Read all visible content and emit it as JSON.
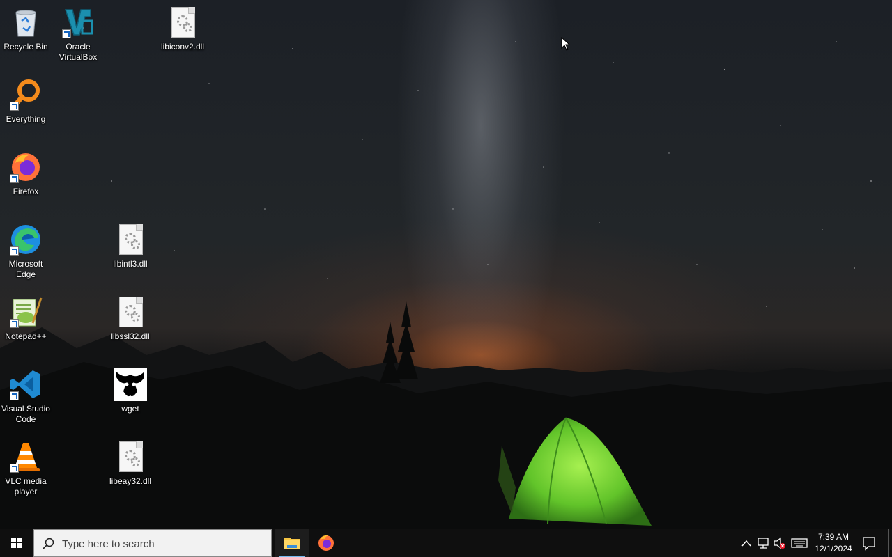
{
  "desktop": {
    "icons": [
      {
        "name": "recycle-bin",
        "label": "Recycle Bin"
      },
      {
        "name": "oracle-virtualbox",
        "label": "Oracle VirtualBox"
      },
      {
        "name": "libiconv2-dll",
        "label": "libiconv2.dll"
      },
      {
        "name": "everything",
        "label": "Everything"
      },
      {
        "name": "firefox",
        "label": "Firefox"
      },
      {
        "name": "microsoft-edge",
        "label": "Microsoft Edge"
      },
      {
        "name": "libintl3-dll",
        "label": "libintl3.dll"
      },
      {
        "name": "notepad-plus-plus",
        "label": "Notepad++"
      },
      {
        "name": "libssl32-dll",
        "label": "libssl32.dll"
      },
      {
        "name": "visual-studio-code",
        "label": "Visual Studio Code"
      },
      {
        "name": "wget",
        "label": "wget"
      },
      {
        "name": "vlc-media-player",
        "label": "VLC media player"
      },
      {
        "name": "libeay32-dll",
        "label": "libeay32.dll"
      }
    ]
  },
  "taskbar": {
    "search_placeholder": "Type here to search",
    "pinned_apps": [
      "file-explorer",
      "firefox"
    ],
    "tray_icons": [
      "show-hidden-icons",
      "network",
      "volume-muted",
      "touch-keyboard"
    ],
    "clock": {
      "time": "7:39 AM",
      "date": "12/1/2024"
    },
    "accent_color": "#76b9ed"
  }
}
